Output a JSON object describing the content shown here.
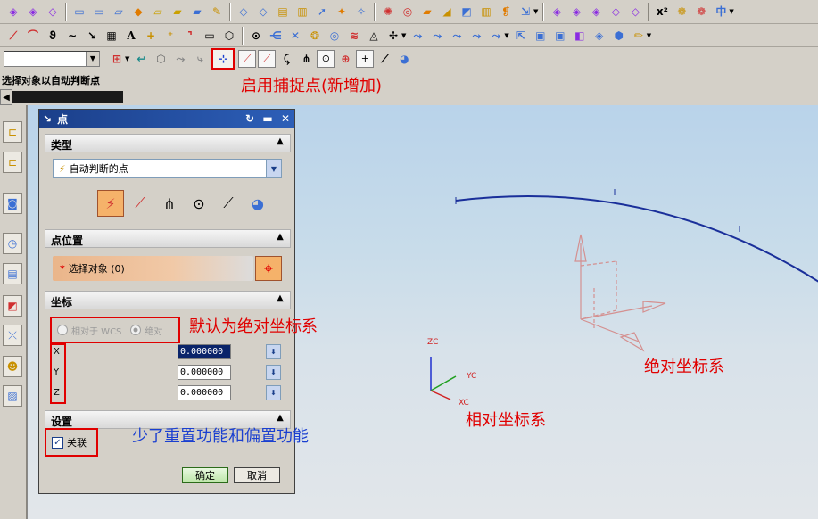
{
  "toolbar": {
    "combo_value": ""
  },
  "status": {
    "prompt": "选择对象以自动判断点"
  },
  "dialog": {
    "title": "点",
    "type_section": {
      "header": "类型",
      "selected": "自动判断的点"
    },
    "position_section": {
      "header": "点位置",
      "select_label": "选择对象 (0)"
    },
    "coord_section": {
      "header": "坐标",
      "radio_relative": "相对于 WCS",
      "radio_absolute": "绝对",
      "x_label": "X",
      "y_label": "Y",
      "z_label": "Z",
      "x_value": "0.000000",
      "y_value": "0.000000",
      "z_value": "0.000000"
    },
    "settings_section": {
      "header": "设置",
      "associative_label": "关联",
      "associative_checked": true
    },
    "ok_label": "确定",
    "cancel_label": "取消"
  },
  "annotations": {
    "snap_point_enabled": "启用捕捉点(新增加)",
    "default_absolute": "默认为绝对坐标系",
    "absolute_cs": "绝对坐标系",
    "relative_cs": "相对坐标系",
    "missing_features": "少了重置功能和偏置功能"
  },
  "triad": {
    "zc": "ZC",
    "yc": "YC",
    "xc": "XC"
  },
  "colors": {
    "annotation_red": "#e00000",
    "annotation_blue": "#1a3fd0",
    "curve": "#1a2f9a",
    "csys": "#d49090"
  }
}
